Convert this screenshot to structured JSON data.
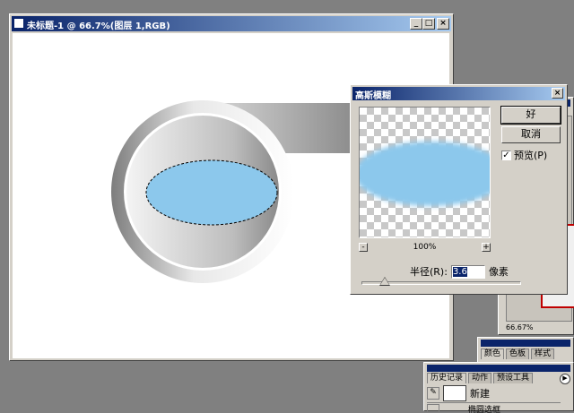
{
  "document": {
    "title": "未标题-1 @ 66.7%(图层 1,RGB)",
    "win_minimize": "_",
    "win_maximize": "□",
    "win_close": "×"
  },
  "dialog": {
    "title": "高斯模糊",
    "close": "×",
    "ok_label": "好",
    "cancel_label": "取消",
    "preview_label": "预览(P)",
    "preview_checked": "✓",
    "zoom_out": "-",
    "zoom_in": "+",
    "zoom_level": "100%",
    "radius_label": "半径(R):",
    "radius_value": "3.6",
    "radius_unit": "像素"
  },
  "navigator": {
    "zoom": "66.67%"
  },
  "color_panel": {
    "tabs": [
      "颜色",
      "色板",
      "样式"
    ]
  },
  "history_panel": {
    "tabs": [
      "历史记录",
      "动作",
      "预设工具"
    ],
    "items": [
      "新建",
      "椭圆选框"
    ]
  },
  "colors": {
    "title_active": "#0a246a",
    "title_fade": "#a6caf0",
    "face": "#d4d0c8",
    "workspace": "#808080",
    "selection_fill": "#8cc8ec"
  }
}
